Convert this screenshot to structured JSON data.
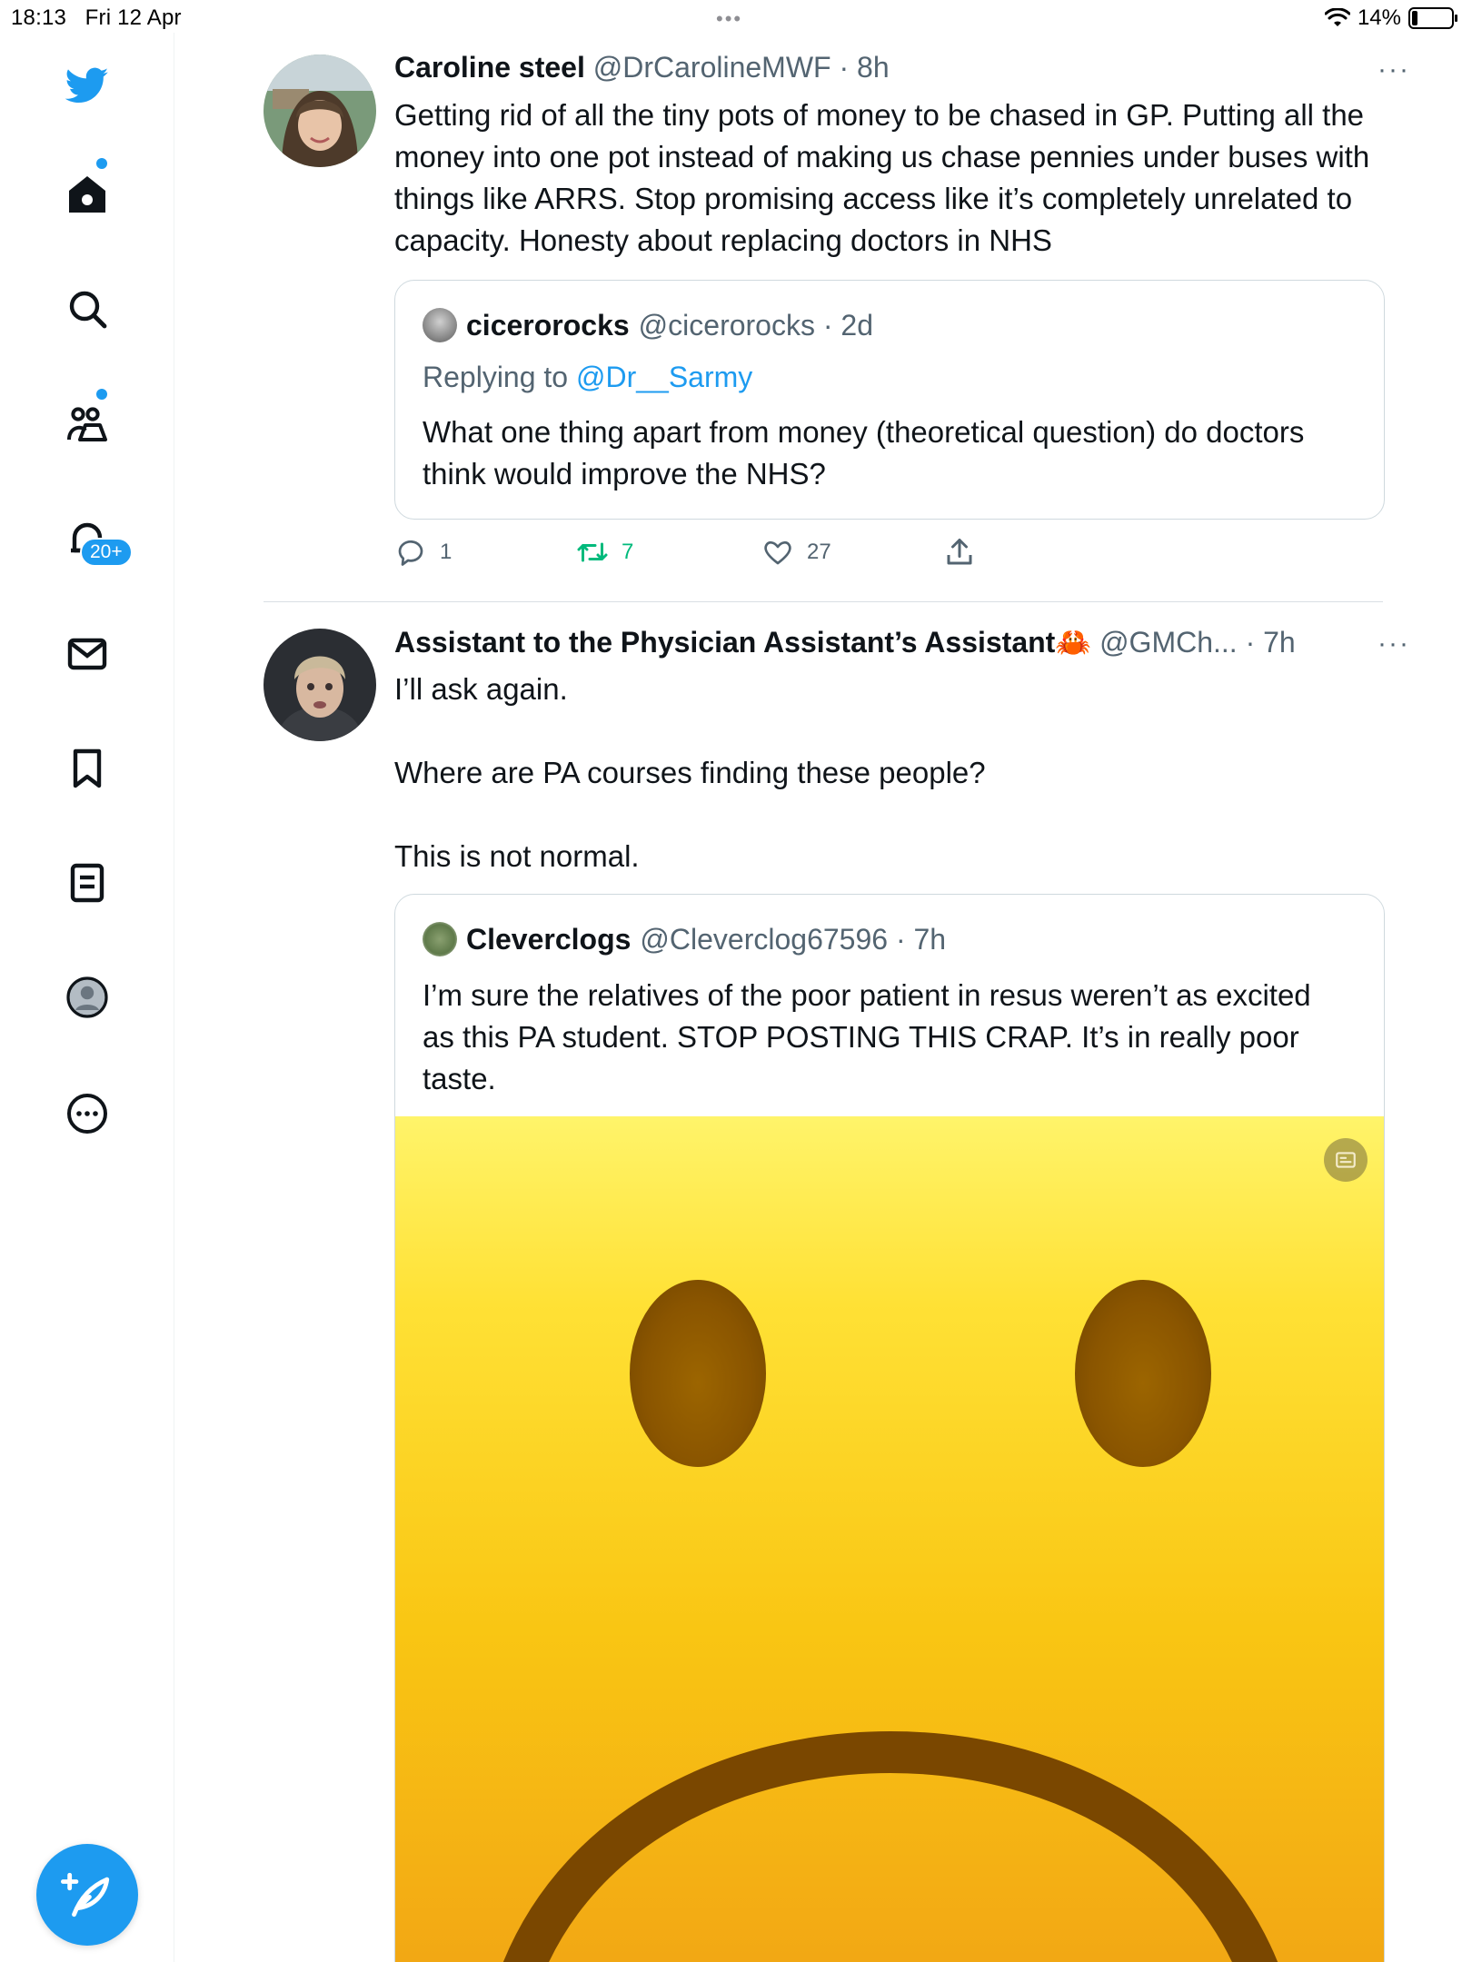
{
  "status_bar": {
    "time": "18:13",
    "date": "Fri 12 Apr",
    "battery": "14%",
    "battery_level": 0.14,
    "multitask": "•••"
  },
  "sidebar": {
    "items": [
      {
        "name": "twitter-logo-icon"
      },
      {
        "name": "home-icon"
      },
      {
        "name": "explore-icon"
      },
      {
        "name": "communities-icon"
      },
      {
        "name": "notifications-icon",
        "badge": "20+"
      },
      {
        "name": "messages-icon"
      },
      {
        "name": "bookmarks-icon"
      },
      {
        "name": "lists-icon"
      },
      {
        "name": "profile-icon"
      },
      {
        "name": "more-icon"
      }
    ],
    "compose": "compose-tweet-icon"
  },
  "tweets": [
    {
      "name": "Caroline steel",
      "handle": "@DrCarolineMWF · 8h",
      "more": "···",
      "text": "Getting rid of all the tiny pots of money to be chased in GP. Putting all the money into one pot instead of making us chase pennies under buses with things like ARRS. Stop promising access like it’s completely unrelated to capacity. Honesty about replacing doctors in NHS",
      "quote": {
        "name": "cicerorocks",
        "handle": "@cicerorocks · 2d",
        "replying_prefix": "Replying to ",
        "replying_to": "@Dr__Sarmy",
        "text": "What one thing apart from money (theoretical question) do doctors think would improve the NHS?"
      },
      "actions": {
        "replies": "1",
        "retweets": "7",
        "likes": "27"
      }
    },
    {
      "name": "Assistant to the Physician Assistant’s Assistant",
      "emoji": "🦀",
      "handle": "@GMCh... · 7h",
      "more": "···",
      "text": "I’ll ask again.\n\nWhere are PA courses finding these people?\n\nThis is not normal.",
      "quote": {
        "name": "Cleverclogs",
        "handle": "@Cleverclog67596 · 7h",
        "text": "I’m sure the relatives of the poor patient in resus weren’t as excited as this PA student. STOP POSTING THIS CRAP. It’s in really poor taste."
      }
    }
  ],
  "colors": {
    "accent": "#1d9bf0",
    "retweet": "#00ba7c",
    "muted": "#536471",
    "border": "#cfd9de"
  }
}
